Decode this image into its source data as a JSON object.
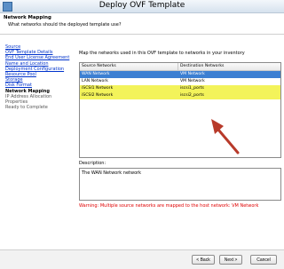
{
  "window": {
    "title": "Deploy OVF Template"
  },
  "header": {
    "title": "Network Mapping",
    "subtitle": "What networks should the deployed template use?"
  },
  "nav": {
    "items": [
      {
        "label": "Source",
        "state": "link"
      },
      {
        "label": "OVF Template Details",
        "state": "link"
      },
      {
        "label": "End User License Agreement",
        "state": "link"
      },
      {
        "label": "Name and Location",
        "state": "link"
      },
      {
        "label": "Deployment Configuration",
        "state": "link"
      },
      {
        "label": "Resource Pool",
        "state": "link"
      },
      {
        "label": "Storage",
        "state": "link"
      },
      {
        "label": "Disk Format",
        "state": "link"
      },
      {
        "label": "Network Mapping",
        "state": "active"
      },
      {
        "label": "IP Address Allocation",
        "state": "disabled"
      },
      {
        "label": "Properties",
        "state": "disabled"
      },
      {
        "label": "Ready to Complete",
        "state": "disabled"
      }
    ]
  },
  "main": {
    "instruction": "Map the networks used in this OVF template to networks in your inventory",
    "columns": [
      "Source Networks",
      "Destination Networks"
    ],
    "rows": [
      {
        "source": "WAN Network",
        "dest": "VM Network",
        "state": "selected"
      },
      {
        "source": "LAN Network",
        "dest": "VM Network",
        "state": "normal"
      },
      {
        "source": "iSCSI1 Network",
        "dest": "iscsi1_ports",
        "state": "highlight"
      },
      {
        "source": "iSCSI2 Network",
        "dest": "iscsi2_ports",
        "state": "highlight"
      }
    ],
    "description_label": "Description:",
    "description_text": "The WAN Network network",
    "warning": "Warning: Multiple source networks are mapped to the host network: VM Network"
  },
  "buttons": {
    "back": "< Back",
    "next": "Next >",
    "cancel": "Cancel"
  },
  "colors": {
    "annotation_arrow": "#b83a2a",
    "highlight": "#f3f35a",
    "selection": "#3c7fd2",
    "warning": "#e00000"
  }
}
